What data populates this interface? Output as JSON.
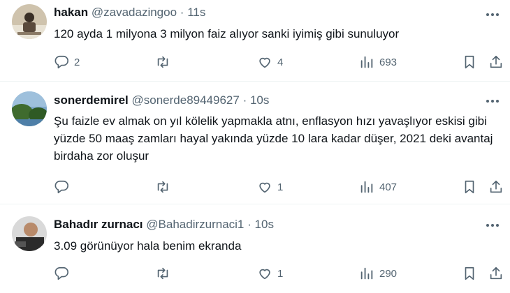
{
  "tweets": [
    {
      "name": "hakan",
      "handle": "@zavadazingoo",
      "separator": "·",
      "time": "11s",
      "text": "120 ayda 1 milyona 3 milyon faiz alıyor sanki iyimiş gibi sunuluyor",
      "replies": "2",
      "retweets": "",
      "likes": "4",
      "views": "693"
    },
    {
      "name": "sonerdemirel",
      "handle": "@sonerde89449627",
      "separator": "·",
      "time": "10s",
      "text": "Şu faizle ev almak on yıl kölelik yapmakla atnı, enflasyon hızı yavaşlıyor eskisi gibi yüzde 50 maaş zamları hayal yakında yüzde 10 lara kadar düşer, 2021 deki avantaj birdaha zor oluşur",
      "replies": "",
      "retweets": "",
      "likes": "1",
      "views": "407"
    },
    {
      "name": "Bahadır zurnacı",
      "handle": "@Bahadirzurnaci1",
      "separator": "·",
      "time": "10s",
      "text": "3.09 görünüyor hala benim ekranda",
      "replies": "",
      "retweets": "",
      "likes": "1",
      "views": "290"
    }
  ],
  "icons": {
    "reply": "reply-icon",
    "retweet": "retweet-icon",
    "like": "heart-icon",
    "views": "views-icon",
    "bookmark": "bookmark-icon",
    "share": "share-icon",
    "more": "more-icon"
  },
  "colors": {
    "text": "#0f1419",
    "secondary": "#536471",
    "divider": "#eff3f4"
  }
}
